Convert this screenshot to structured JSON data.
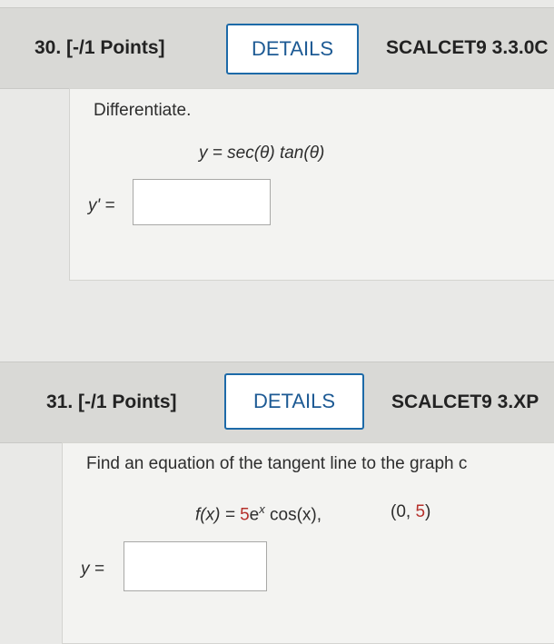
{
  "q30": {
    "number": "30.",
    "points": "[-/1 Points]",
    "details_label": "DETAILS",
    "code": "SCALCET9 3.3.0C",
    "instruction": "Differentiate.",
    "equation": "y = sec(θ) tan(θ)",
    "answer_label": "y' =",
    "answer_value": ""
  },
  "q31": {
    "number": "31.",
    "points": "[-/1 Points]",
    "details_label": "DETAILS",
    "code": "SCALCET9 3.XP",
    "instruction": "Find an equation of the tangent line to the graph c",
    "func_lhs": "f(x) = ",
    "func_coef": "5",
    "func_base": "e",
    "func_exp": "x",
    "func_rest": " cos(x),",
    "point_open": "(0, ",
    "point_y": "5",
    "point_close": ")",
    "answer_label": "y =",
    "answer_value": ""
  }
}
